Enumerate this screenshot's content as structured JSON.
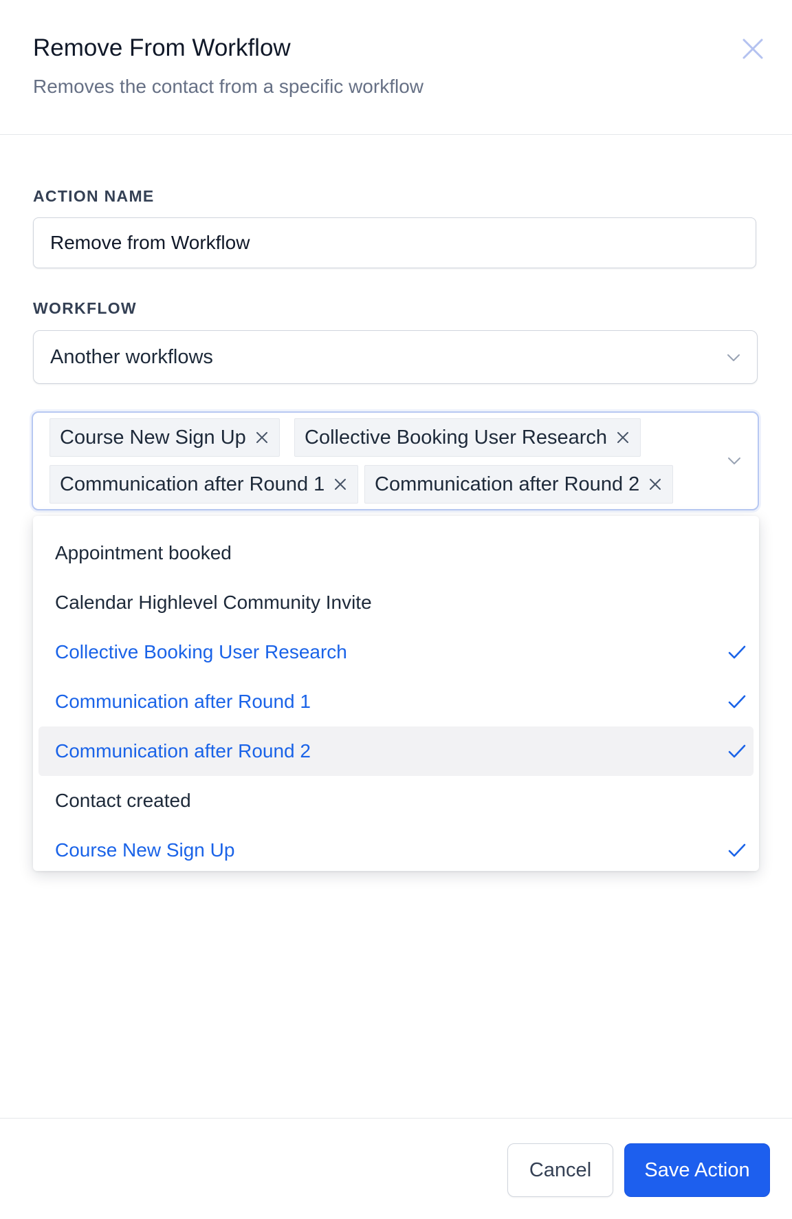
{
  "modal": {
    "title": "Remove From Workflow",
    "subtitle": "Removes the contact from a specific workflow"
  },
  "action_name": {
    "label": "ACTION NAME",
    "value": "Remove from Workflow"
  },
  "workflow": {
    "label": "WORKFLOW",
    "selected": "Another workflows"
  },
  "selected_tags": [
    "Course New Sign Up",
    "Collective Booking User Research",
    "Communication after Round 1",
    "Communication after Round 2"
  ],
  "dropdown_options": [
    {
      "label": "Appointment booked",
      "selected": false
    },
    {
      "label": "Calendar Highlevel Community Invite",
      "selected": false
    },
    {
      "label": "Collective Booking User Research",
      "selected": true
    },
    {
      "label": "Communication after Round 1",
      "selected": true
    },
    {
      "label": "Communication after Round 2",
      "selected": true,
      "highlighted": true
    },
    {
      "label": "Contact created",
      "selected": false
    },
    {
      "label": "Course New Sign Up",
      "selected": true
    }
  ],
  "footer": {
    "cancel_label": "Cancel",
    "save_label": "Save Action"
  },
  "colors": {
    "accent": "#1d5fee",
    "selected_text": "#1a63e8",
    "focus_border": "#b7c8f2"
  },
  "icons": [
    "close-icon",
    "chevron-down-icon",
    "tag-remove-icon",
    "check-icon"
  ]
}
